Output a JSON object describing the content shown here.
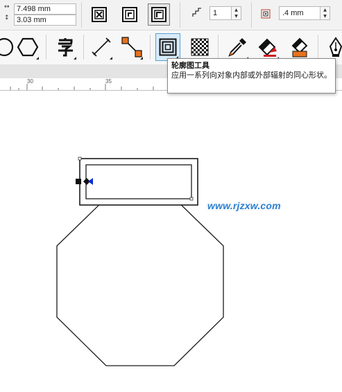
{
  "property_bar": {
    "width_value": "7.498 mm",
    "height_value": "3.03 mm",
    "width_icon": "width-arrows-icon",
    "height_icon": "height-arrows-icon",
    "contour_modes": [
      "contour-to-center-icon",
      "contour-inside-icon",
      "contour-outside-icon"
    ],
    "active_mode": "contour-outside-icon",
    "steps_value": "1",
    "offset_value": ".4 mm"
  },
  "toolbox": {
    "tools": [
      "ellipse-tool-icon",
      "polygon-tool-icon",
      "text-tool-icon",
      "parallel-dimension-tool-icon",
      "connector-tool-icon",
      "contour-tool-icon",
      "transparency-tool-icon",
      "eyedropper-tool-icon",
      "interactive-fill-tool-icon",
      "smart-fill-tool-icon",
      "pen-tool-icon"
    ],
    "active_tool": "contour-tool-icon"
  },
  "ruler": {
    "labels": [
      "30",
      "35"
    ]
  },
  "tooltip": {
    "title": "轮廓图工具",
    "description": "应用一系列向对象内部或外部辐射的同心形状。"
  },
  "watermark": "www.rjzxw.com",
  "colors": {
    "active_tool_bg": "#d9ebf8",
    "active_tool_border": "#57a0d6",
    "watermark": "#2a7fd0",
    "orange_node": "#e8721c"
  }
}
